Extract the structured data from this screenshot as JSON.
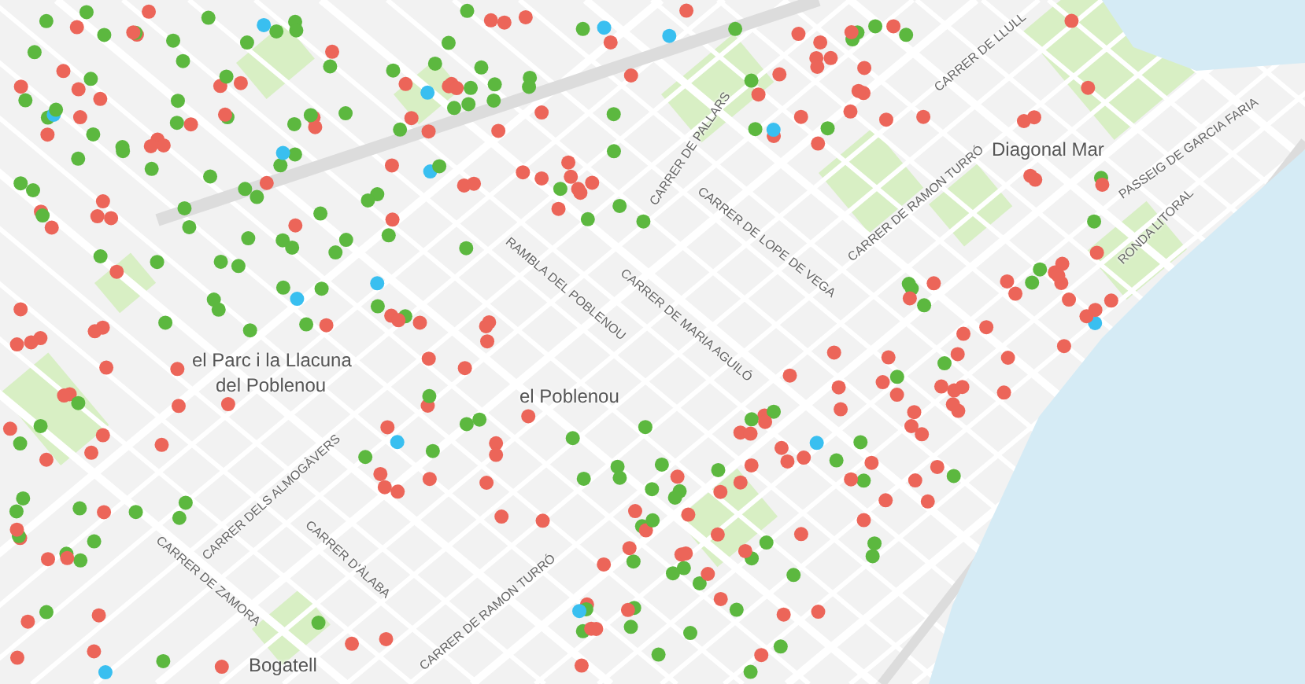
{
  "map": {
    "labels": [
      {
        "kind": "place",
        "text": "el Parc i la Llacuna"
      },
      {
        "kind": "place",
        "text": "del Poblenou"
      },
      {
        "kind": "place",
        "text": "el Poblenou"
      },
      {
        "kind": "place",
        "text": "Diagonal Mar"
      },
      {
        "kind": "place",
        "text": "Bogatell"
      },
      {
        "kind": "street",
        "text": "CARRER DE PALLARS"
      },
      {
        "kind": "street",
        "text": "CARRER DE LOPE DE VEGA"
      },
      {
        "kind": "street",
        "text": "RAMBLA DEL POBLENOU"
      },
      {
        "kind": "street",
        "text": "CARRER DE MARIA AGUILÓ"
      },
      {
        "kind": "street",
        "text": "CARRER DE RAMON TURRÓ"
      },
      {
        "kind": "street",
        "text": "CARRER DE LLULL"
      },
      {
        "kind": "street",
        "text": "PASSEIG DE GARCIA FARIA"
      },
      {
        "kind": "street",
        "text": "RONDA LITORAL"
      },
      {
        "kind": "street",
        "text": "CARRER DELS ALMOGÀVERS"
      },
      {
        "kind": "street",
        "text": "CARRER DE ZAMORA"
      },
      {
        "kind": "street",
        "text": "CARRER D'ÀLABA"
      },
      {
        "kind": "street",
        "text": "CARRER DE RAMON TURRÓ"
      }
    ]
  }
}
